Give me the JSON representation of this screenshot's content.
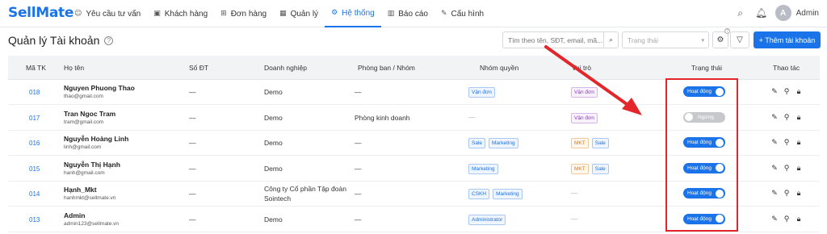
{
  "app": {
    "logo": "SellMate"
  },
  "nav": {
    "items": [
      {
        "label": "Yêu cầu tư vấn",
        "icon": "smiley-icon",
        "glyph": "☺"
      },
      {
        "label": "Khách hàng",
        "icon": "id-card-icon",
        "glyph": "▣"
      },
      {
        "label": "Đơn hàng",
        "icon": "cart-icon",
        "glyph": "⊞"
      },
      {
        "label": "Quản lý",
        "icon": "grid-icon",
        "glyph": "▦"
      },
      {
        "label": "Hệ thống",
        "icon": "gear-icon",
        "glyph": "⚙",
        "active": true
      },
      {
        "label": "Báo cáo",
        "icon": "chart-icon",
        "glyph": "▥"
      },
      {
        "label": "Cấu hình",
        "icon": "wrench-icon",
        "glyph": "✎"
      }
    ]
  },
  "topbar": {
    "avatar_letter": "A",
    "user_name": "Admin"
  },
  "page": {
    "title": "Quản lý Tài khoản",
    "help_glyph": "?",
    "search_placeholder": "Tìm theo tên, SĐT, email, mã...",
    "status_placeholder": "Trạng thái",
    "settings_badge": "?",
    "add_button": "+ Thêm tài khoản"
  },
  "table": {
    "headers": {
      "code": "Mã TK",
      "name": "Họ tên",
      "phone": "Số ĐT",
      "company": "Doanh nghiệp",
      "department": "Phòng ban / Nhóm",
      "permission_group": "Nhóm quyền",
      "role": "Vai trò",
      "status": "Trạng thái",
      "actions": "Thao tác"
    },
    "rows": [
      {
        "code": "018",
        "name": "Nguyen Phuong Thao",
        "email": "thao@gmail.com",
        "phone": "—",
        "company": "Demo",
        "department": "—",
        "groups": [
          "Vận đơn"
        ],
        "roles": [
          {
            "label": "Vận đơn",
            "color": "purple"
          }
        ],
        "status": "Hoạt động",
        "active": true
      },
      {
        "code": "017",
        "name": "Tran Ngoc Tram",
        "email": "tram@gmail.com",
        "phone": "—",
        "company": "Demo",
        "department": "Phòng kinh doanh",
        "groups": [],
        "roles": [
          {
            "label": "Vận đơn",
            "color": "purple"
          }
        ],
        "status": "Ngừng",
        "active": false
      },
      {
        "code": "016",
        "name": "Nguyễn Hoàng Linh",
        "email": "linh@gmail.com",
        "phone": "—",
        "company": "Demo",
        "department": "—",
        "groups": [
          "Sale",
          "Marketing"
        ],
        "roles": [
          {
            "label": "MKT",
            "color": "orange"
          },
          {
            "label": "Sale",
            "color": "blue"
          }
        ],
        "status": "Hoạt động",
        "active": true
      },
      {
        "code": "015",
        "name": "Nguyễn Thị Hạnh",
        "email": "hanh@gmail.com",
        "phone": "—",
        "company": "Demo",
        "department": "—",
        "groups": [
          "Marketing"
        ],
        "roles": [
          {
            "label": "MKT",
            "color": "orange"
          },
          {
            "label": "Sale",
            "color": "blue"
          }
        ],
        "status": "Hoạt động",
        "active": true
      },
      {
        "code": "014",
        "name": "Hạnh_Mkt",
        "email": "hanhmkt@sellmate.vn",
        "phone": "—",
        "company": "Công ty Cổ phần Tập đoàn Sointech",
        "department": "—",
        "groups": [
          "CSKH",
          "Marketing"
        ],
        "roles": [],
        "status": "Hoạt động",
        "active": true
      },
      {
        "code": "013",
        "name": "Admin",
        "email": "admin123@sellmate.vn",
        "phone": "—",
        "company": "Demo",
        "department": "—",
        "groups": [
          "Administrator"
        ],
        "roles": [],
        "status": "Hoạt động",
        "active": true
      }
    ],
    "empty_cell": "—"
  },
  "colors": {
    "accent": "#1a73e8",
    "annotation_red": "#e3262a"
  }
}
